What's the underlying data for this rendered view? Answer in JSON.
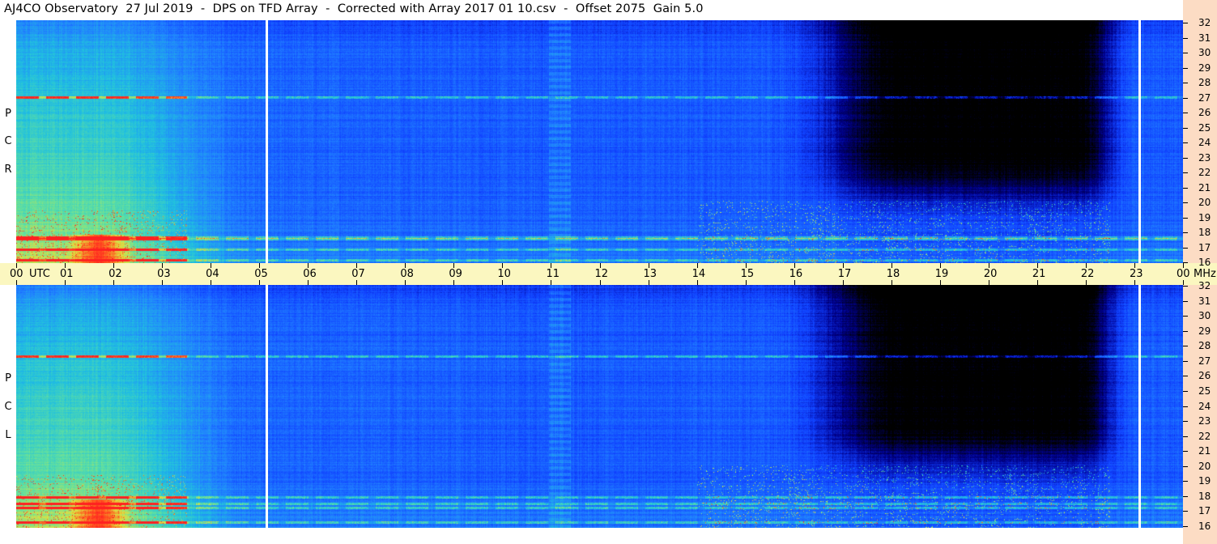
{
  "title": "AJ4CO Observatory  27 Jul 2019  -  DPS on TFD Array  -  Corrected with Array 2017 01 10.csv  -  Offset 2075  Gain 5.0",
  "chart_data": {
    "type": "heatmap",
    "description_type": "dynamic spectrogram",
    "panels": [
      {
        "name": "R C P",
        "polarization_letters": [
          "R",
          "C",
          "P"
        ]
      },
      {
        "name": "L C P",
        "polarization_letters": [
          "L",
          "C",
          "P"
        ]
      }
    ],
    "x_axis": {
      "unit": "UTC",
      "range_hours": [
        0,
        24
      ],
      "tick_labels": [
        "00",
        "01",
        "02",
        "03",
        "04",
        "05",
        "06",
        "07",
        "08",
        "09",
        "10",
        "11",
        "12",
        "13",
        "14",
        "15",
        "16",
        "17",
        "18",
        "19",
        "20",
        "21",
        "22",
        "23",
        "00"
      ]
    },
    "y_axis": {
      "unit": "MHz",
      "range": [
        16,
        32
      ],
      "tick_labels": [
        "32",
        "31",
        "30",
        "29",
        "28",
        "27",
        "26",
        "25",
        "24",
        "23",
        "22",
        "21",
        "20",
        "19",
        "18",
        "17",
        "16"
      ]
    },
    "data_gaps_utc": [
      5.15,
      23.1
    ],
    "colormap": [
      "#000000",
      "#00008b",
      "#1040ff",
      "#2080ff",
      "#20c0e0",
      "#60e0a0",
      "#e0e040",
      "#ff6020",
      "#ff2020"
    ]
  },
  "labels": {
    "utc_unit": "UTC",
    "mhz_unit": "MHz"
  }
}
